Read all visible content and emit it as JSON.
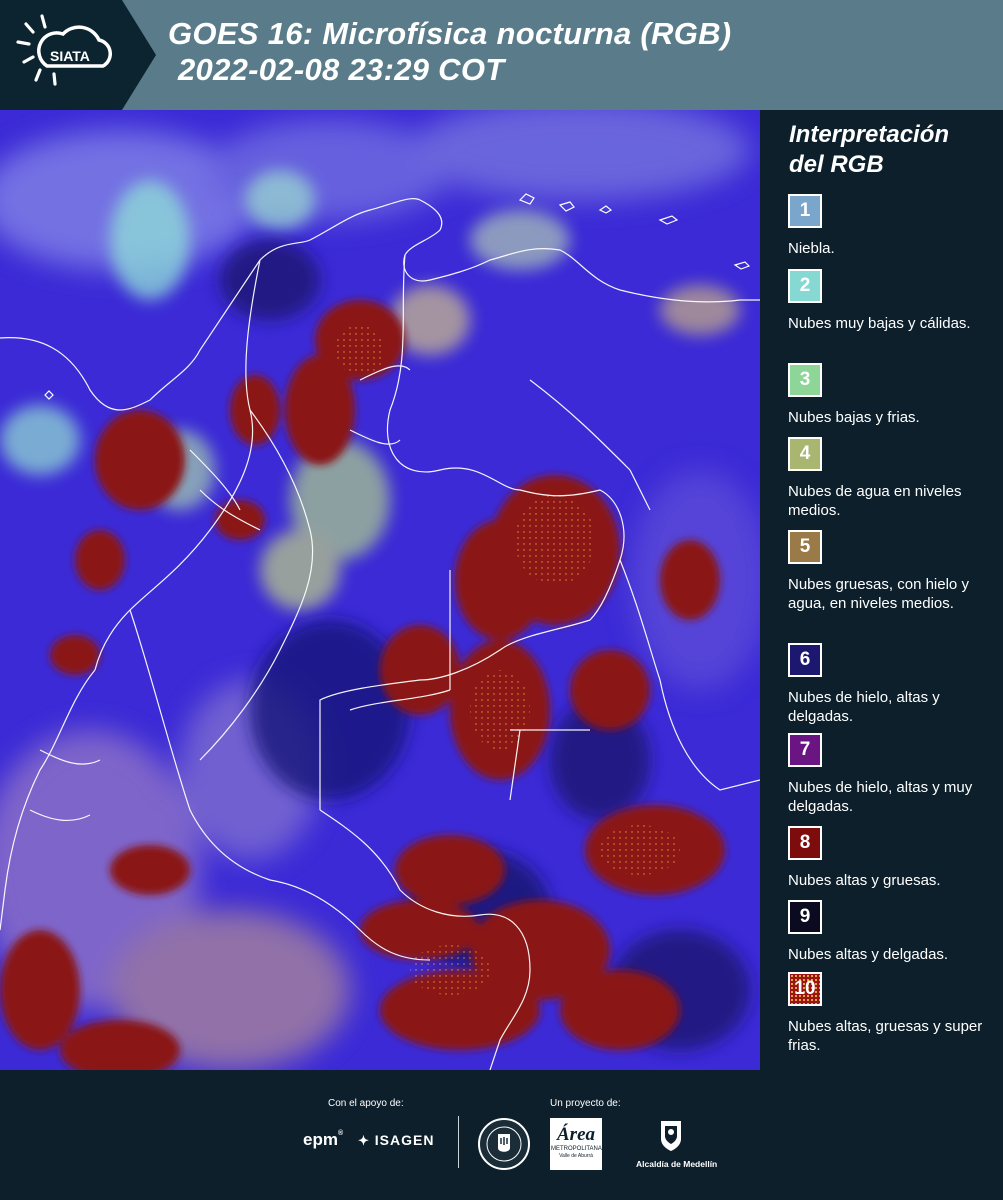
{
  "header": {
    "logo_text": "SIATA",
    "title_line1": "GOES 16: Microfísica nocturna (RGB)",
    "title_line2": "2022-02-08 23:29 COT"
  },
  "map": {
    "icon": "satellite-rgb-image",
    "colors": {
      "background": "#3a2ad8",
      "deep_convection": "#8a1a1a",
      "thin_ice": "#1a1a7a",
      "borders": "#ffffff"
    }
  },
  "legend": {
    "title": "Interpretación del RGB",
    "items": [
      {
        "number": "1",
        "label": "Niebla.",
        "color": "#7aa6cc"
      },
      {
        "number": "2",
        "label": "Nubes muy bajas y cálidas.",
        "color": "#86d8d2"
      },
      {
        "number": "3",
        "label": "Nubes bajas y frias.",
        "color": "#8ed698"
      },
      {
        "number": "4",
        "label": "Nubes de agua en niveles medios.",
        "color": "#a9b66f"
      },
      {
        "number": "5",
        "label": "Nubes gruesas, con hielo y agua, en niveles medios.",
        "color": "#9a7a47"
      },
      {
        "number": "6",
        "label": "Nubes de hielo, altas y delgadas.",
        "color": "#1c1870"
      },
      {
        "number": "7",
        "label": "Nubes de hielo, altas y muy delgadas.",
        "color": "#6b1583"
      },
      {
        "number": "8",
        "label": "Nubes altas y gruesas.",
        "color": "#7d0d0d"
      },
      {
        "number": "9",
        "label": "Nubes altas y delgadas.",
        "color": "#0a0a20"
      },
      {
        "number": "10",
        "label": "Nubes altas, gruesas y super frias.",
        "color": "#9a1414"
      }
    ]
  },
  "footer": {
    "support_caption": "Con el apoyo de:",
    "project_caption": "Un proyecto de:",
    "epm_logo": "epm",
    "isagen_logo": "ISAGEN",
    "metropolitana_logo_title": "Área",
    "metropolitana_logo_sub": "METROPOLITANA",
    "metropolitana_logo_sub2": "Valle de Aburrá",
    "alcaldia_logo": "Alcaldía de Medellín"
  }
}
